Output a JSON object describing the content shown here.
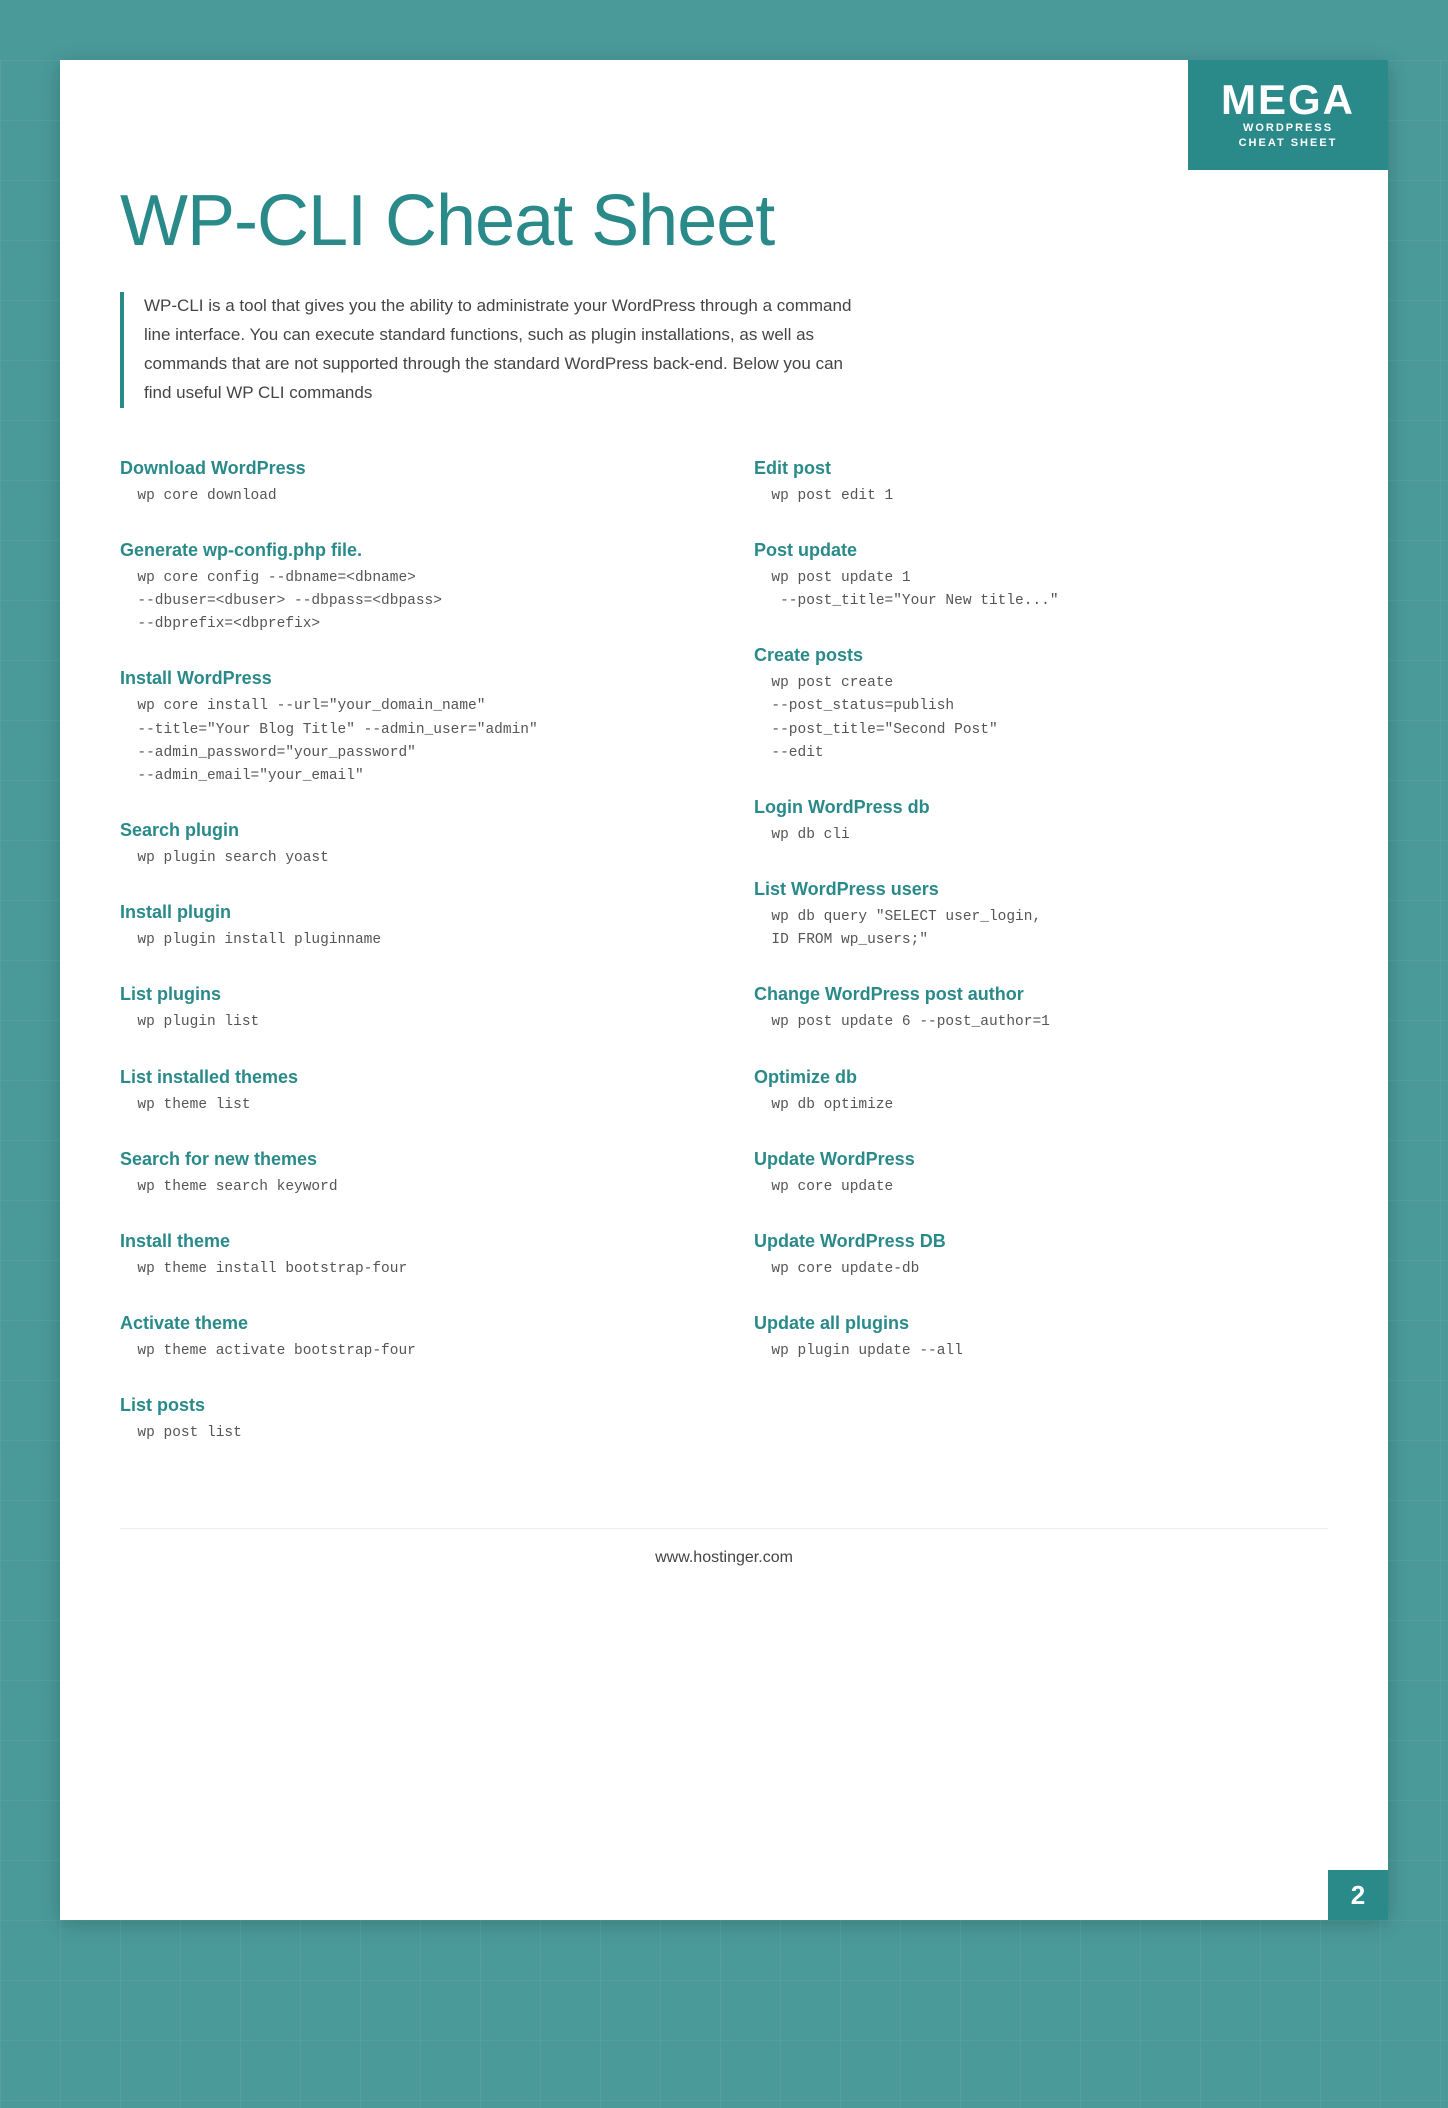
{
  "logo": {
    "mega": "MEGA",
    "line1": "WORDPRESS",
    "line2": "CHEAT SHEET"
  },
  "title": "WP-CLI Cheat Sheet",
  "intro": "WP-CLI is a tool that gives you the ability to administrate your WordPress through a command line interface. You can execute standard functions, such as plugin installations, as well as commands that are not supported through the standard WordPress back-end. Below you can find useful WP CLI commands",
  "footer_url": "www.hostinger.com",
  "page_number": "2",
  "left_sections": [
    {
      "title": "Download WordPress",
      "code": "  wp core download"
    },
    {
      "title": "Generate wp-config.php file.",
      "code": "  wp core config --dbname=<dbname>\n  --dbuser=<dbuser> --dbpass=<dbpass>\n  --dbprefix=<dbprefix>"
    },
    {
      "title": "Install WordPress",
      "code": "  wp core install --url=\"your_domain_name\"\n  --title=\"Your Blog Title\" --admin_user=\"admin\"\n  --admin_password=\"your_password\"\n  --admin_email=\"your_email\""
    },
    {
      "title": "Search plugin",
      "code": "  wp plugin search yoast"
    },
    {
      "title": "Install plugin",
      "code": "  wp plugin install pluginname"
    },
    {
      "title": "List plugins",
      "code": "  wp plugin list"
    },
    {
      "title": "List installed themes",
      "code": "  wp theme list"
    },
    {
      "title": "Search for new themes",
      "code": "  wp theme search keyword"
    },
    {
      "title": "Install theme",
      "code": "  wp theme install bootstrap-four"
    },
    {
      "title": "Activate theme",
      "code": "  wp theme activate bootstrap-four"
    },
    {
      "title": "List posts",
      "code": "  wp post list"
    }
  ],
  "right_sections": [
    {
      "title": "Edit post",
      "code": "  wp post edit 1"
    },
    {
      "title": "Post update",
      "code": "  wp post update 1\n   --post_title=\"Your New title...\""
    },
    {
      "title": "Create posts",
      "code": "  wp post create\n  --post_status=publish\n  --post_title=\"Second Post\"\n  --edit"
    },
    {
      "title": "Login WordPress db",
      "code": "  wp db cli"
    },
    {
      "title": "List WordPress users",
      "code": "  wp db query \"SELECT user_login,\n  ID FROM wp_users;\""
    },
    {
      "title": "Change WordPress post author",
      "code": "  wp post update 6 --post_author=1"
    },
    {
      "title": "Optimize db",
      "code": "  wp db optimize"
    },
    {
      "title": "Update WordPress",
      "code": "  wp core update"
    },
    {
      "title": "Update WordPress DB",
      "code": "  wp core update-db"
    },
    {
      "title": "Update all plugins",
      "code": "  wp plugin update --all"
    }
  ]
}
